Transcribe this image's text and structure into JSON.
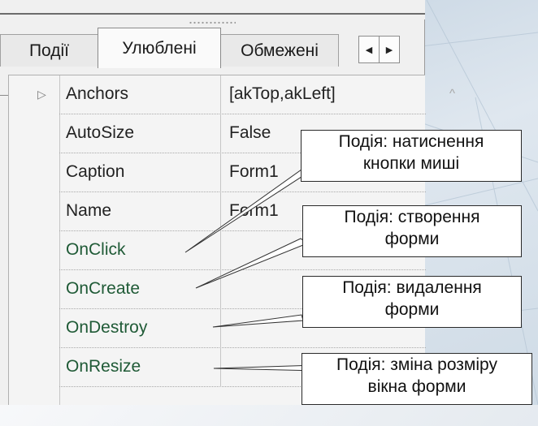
{
  "tabs": [
    {
      "label": "Події",
      "active": false
    },
    {
      "label": "Улюблені",
      "active": true
    },
    {
      "label": "Обмежені",
      "active": false
    }
  ],
  "tab_scroll": {
    "left_icon": "arrow-left-icon",
    "right_icon": "arrow-right-icon"
  },
  "properties": [
    {
      "name": "Anchors",
      "value": "[akTop,akLeft]"
    },
    {
      "name": "AutoSize",
      "value": "False"
    },
    {
      "name": "Caption",
      "value": "Form1"
    },
    {
      "name": "Name",
      "value": "Form1"
    },
    {
      "name": "OnClick",
      "value": ""
    },
    {
      "name": "OnCreate",
      "value": ""
    },
    {
      "name": "OnDestroy",
      "value": ""
    },
    {
      "name": "OnResize",
      "value": ""
    }
  ],
  "callouts": [
    {
      "line1": "Подія: натиснення",
      "line2": "кнопки миші"
    },
    {
      "line1": "Подія: створення",
      "line2": "форми"
    },
    {
      "line1": "Подія: видалення",
      "line2": "форми"
    },
    {
      "line1": "Подія: зміна розміру",
      "line2": "вікна форми"
    }
  ],
  "colors": {
    "event_name": "#1f5a36",
    "panel_bg": "#f0f0f0",
    "callout_border": "#2a2a2a"
  }
}
